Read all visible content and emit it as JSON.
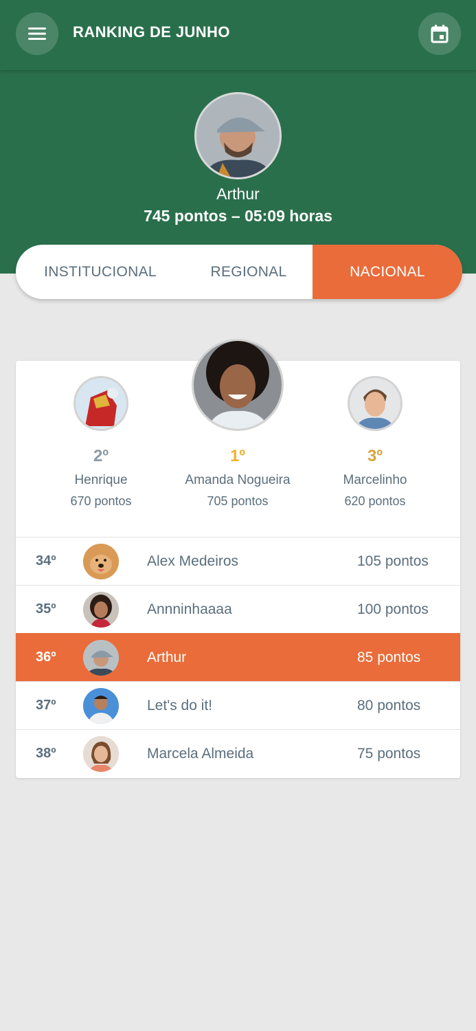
{
  "header": {
    "title": "RANKING DE JUNHO",
    "menu_icon": "menu-icon",
    "calendar_icon": "calendar-icon"
  },
  "profile": {
    "name": "Arthur",
    "stats": "745 pontos – 05:09 horas"
  },
  "tabs": [
    {
      "label": "INSTITUCIONAL",
      "active": false
    },
    {
      "label": "REGIONAL",
      "active": false
    },
    {
      "label": "NACIONAL",
      "active": true
    }
  ],
  "podium": [
    {
      "place": "2º",
      "name": "Henrique",
      "points": "670 pontos"
    },
    {
      "place": "1º",
      "name": "Amanda Nogueira",
      "points": "705 pontos"
    },
    {
      "place": "3º",
      "name": "Marcelinho",
      "points": "620 pontos"
    }
  ],
  "ranking": [
    {
      "pos": "34º",
      "name": "Alex Medeiros",
      "points": "105 pontos"
    },
    {
      "pos": "35º",
      "name": "Annninhaaaa",
      "points": "100 pontos"
    },
    {
      "pos": "36º",
      "name": "Arthur",
      "points": "85 pontos",
      "current_user": true
    },
    {
      "pos": "37º",
      "name": "Let's do it!",
      "points": "80 pontos"
    },
    {
      "pos": "38º",
      "name": "Marcela Almeida",
      "points": "75 pontos"
    }
  ],
  "colors": {
    "primary_green": "#2a6f4c",
    "accent_orange": "#e96c3a",
    "text_gray": "#5b6e7c",
    "gold": "#f0b12a",
    "silver": "#8b9aa5",
    "bronze": "#d9a33a"
  }
}
